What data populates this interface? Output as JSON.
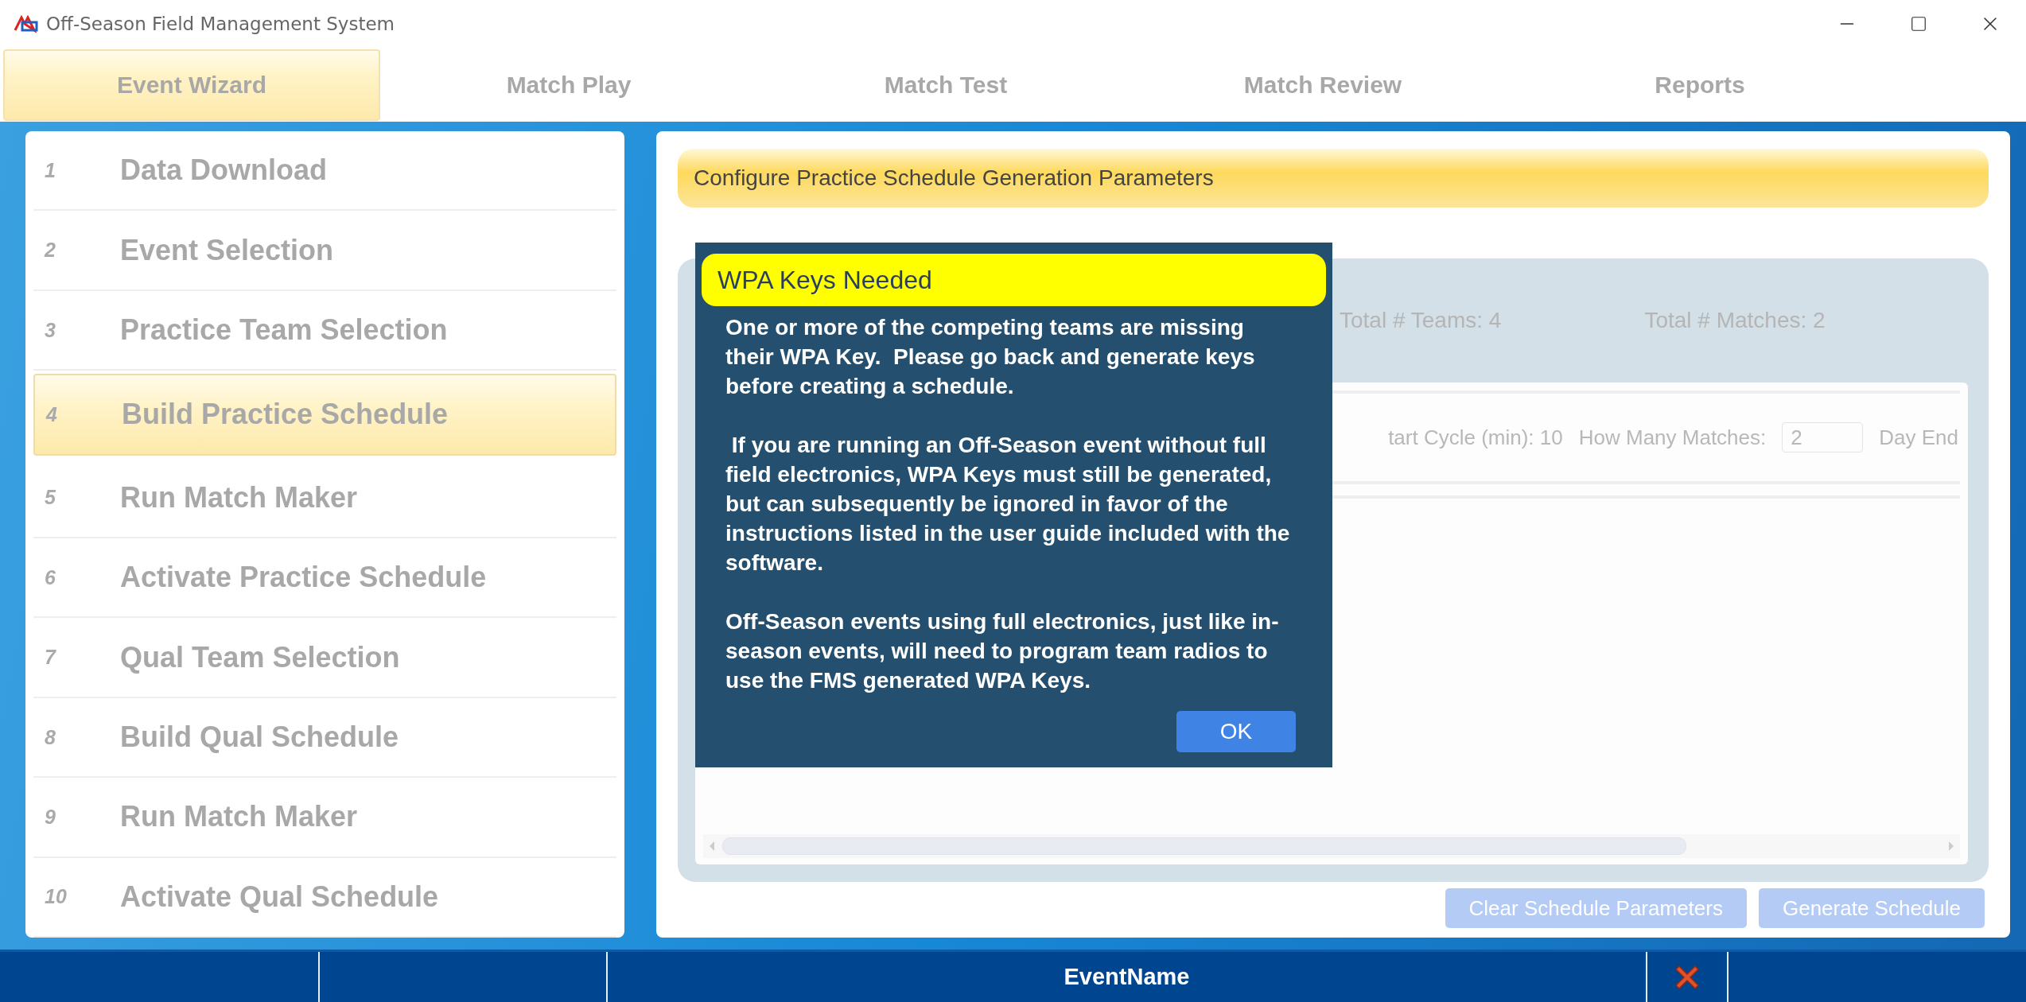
{
  "window": {
    "title": "Off-Season Field Management System"
  },
  "tabs": [
    {
      "label": "Event Wizard",
      "selected": true
    },
    {
      "label": "Match Play",
      "selected": false
    },
    {
      "label": "Match Test",
      "selected": false
    },
    {
      "label": "Match Review",
      "selected": false
    },
    {
      "label": "Reports",
      "selected": false
    }
  ],
  "wizard_steps": [
    {
      "number": "1",
      "label": "Data Download",
      "selected": false
    },
    {
      "number": "2",
      "label": "Event Selection",
      "selected": false
    },
    {
      "number": "3",
      "label": "Practice Team Selection",
      "selected": false
    },
    {
      "number": "4",
      "label": "Build Practice Schedule",
      "selected": true
    },
    {
      "number": "5",
      "label": "Run Match Maker",
      "selected": false
    },
    {
      "number": "6",
      "label": "Activate Practice Schedule",
      "selected": false
    },
    {
      "number": "7",
      "label": "Qual Team Selection",
      "selected": false
    },
    {
      "number": "8",
      "label": "Build Qual Schedule",
      "selected": false
    },
    {
      "number": "9",
      "label": "Run Match Maker",
      "selected": false
    },
    {
      "number": "10",
      "label": "Activate Qual Schedule",
      "selected": false
    }
  ],
  "panel": {
    "title": "Configure Practice Schedule Generation Parameters",
    "stats": [
      "Total # Teams: 4",
      "Total # Matches: 2"
    ],
    "params": {
      "cycle": "tart Cycle (min): 10",
      "matches_label": "How Many Matches:",
      "matches_value": "2",
      "day_end": "Day End"
    },
    "buttons": [
      "Clear Schedule Parameters",
      "Generate Schedule"
    ]
  },
  "dialog": {
    "title": "WPA Keys Needed",
    "paragraphs": [
      "One or more of the competing teams are missing their WPA Key.  Please go back and generate keys before creating a schedule.",
      " If you are running an Off-Season event without full field electronics, WPA Keys must still be generated, but can subsequently be ignored in favor of the instructions listed in the user guide included with the software.",
      "Off-Season events using full electronics, just like in-season events, will need to program team radios to use the FMS generated WPA Keys."
    ],
    "button": "OK"
  },
  "status_bar": {
    "event_name": "EventName"
  }
}
